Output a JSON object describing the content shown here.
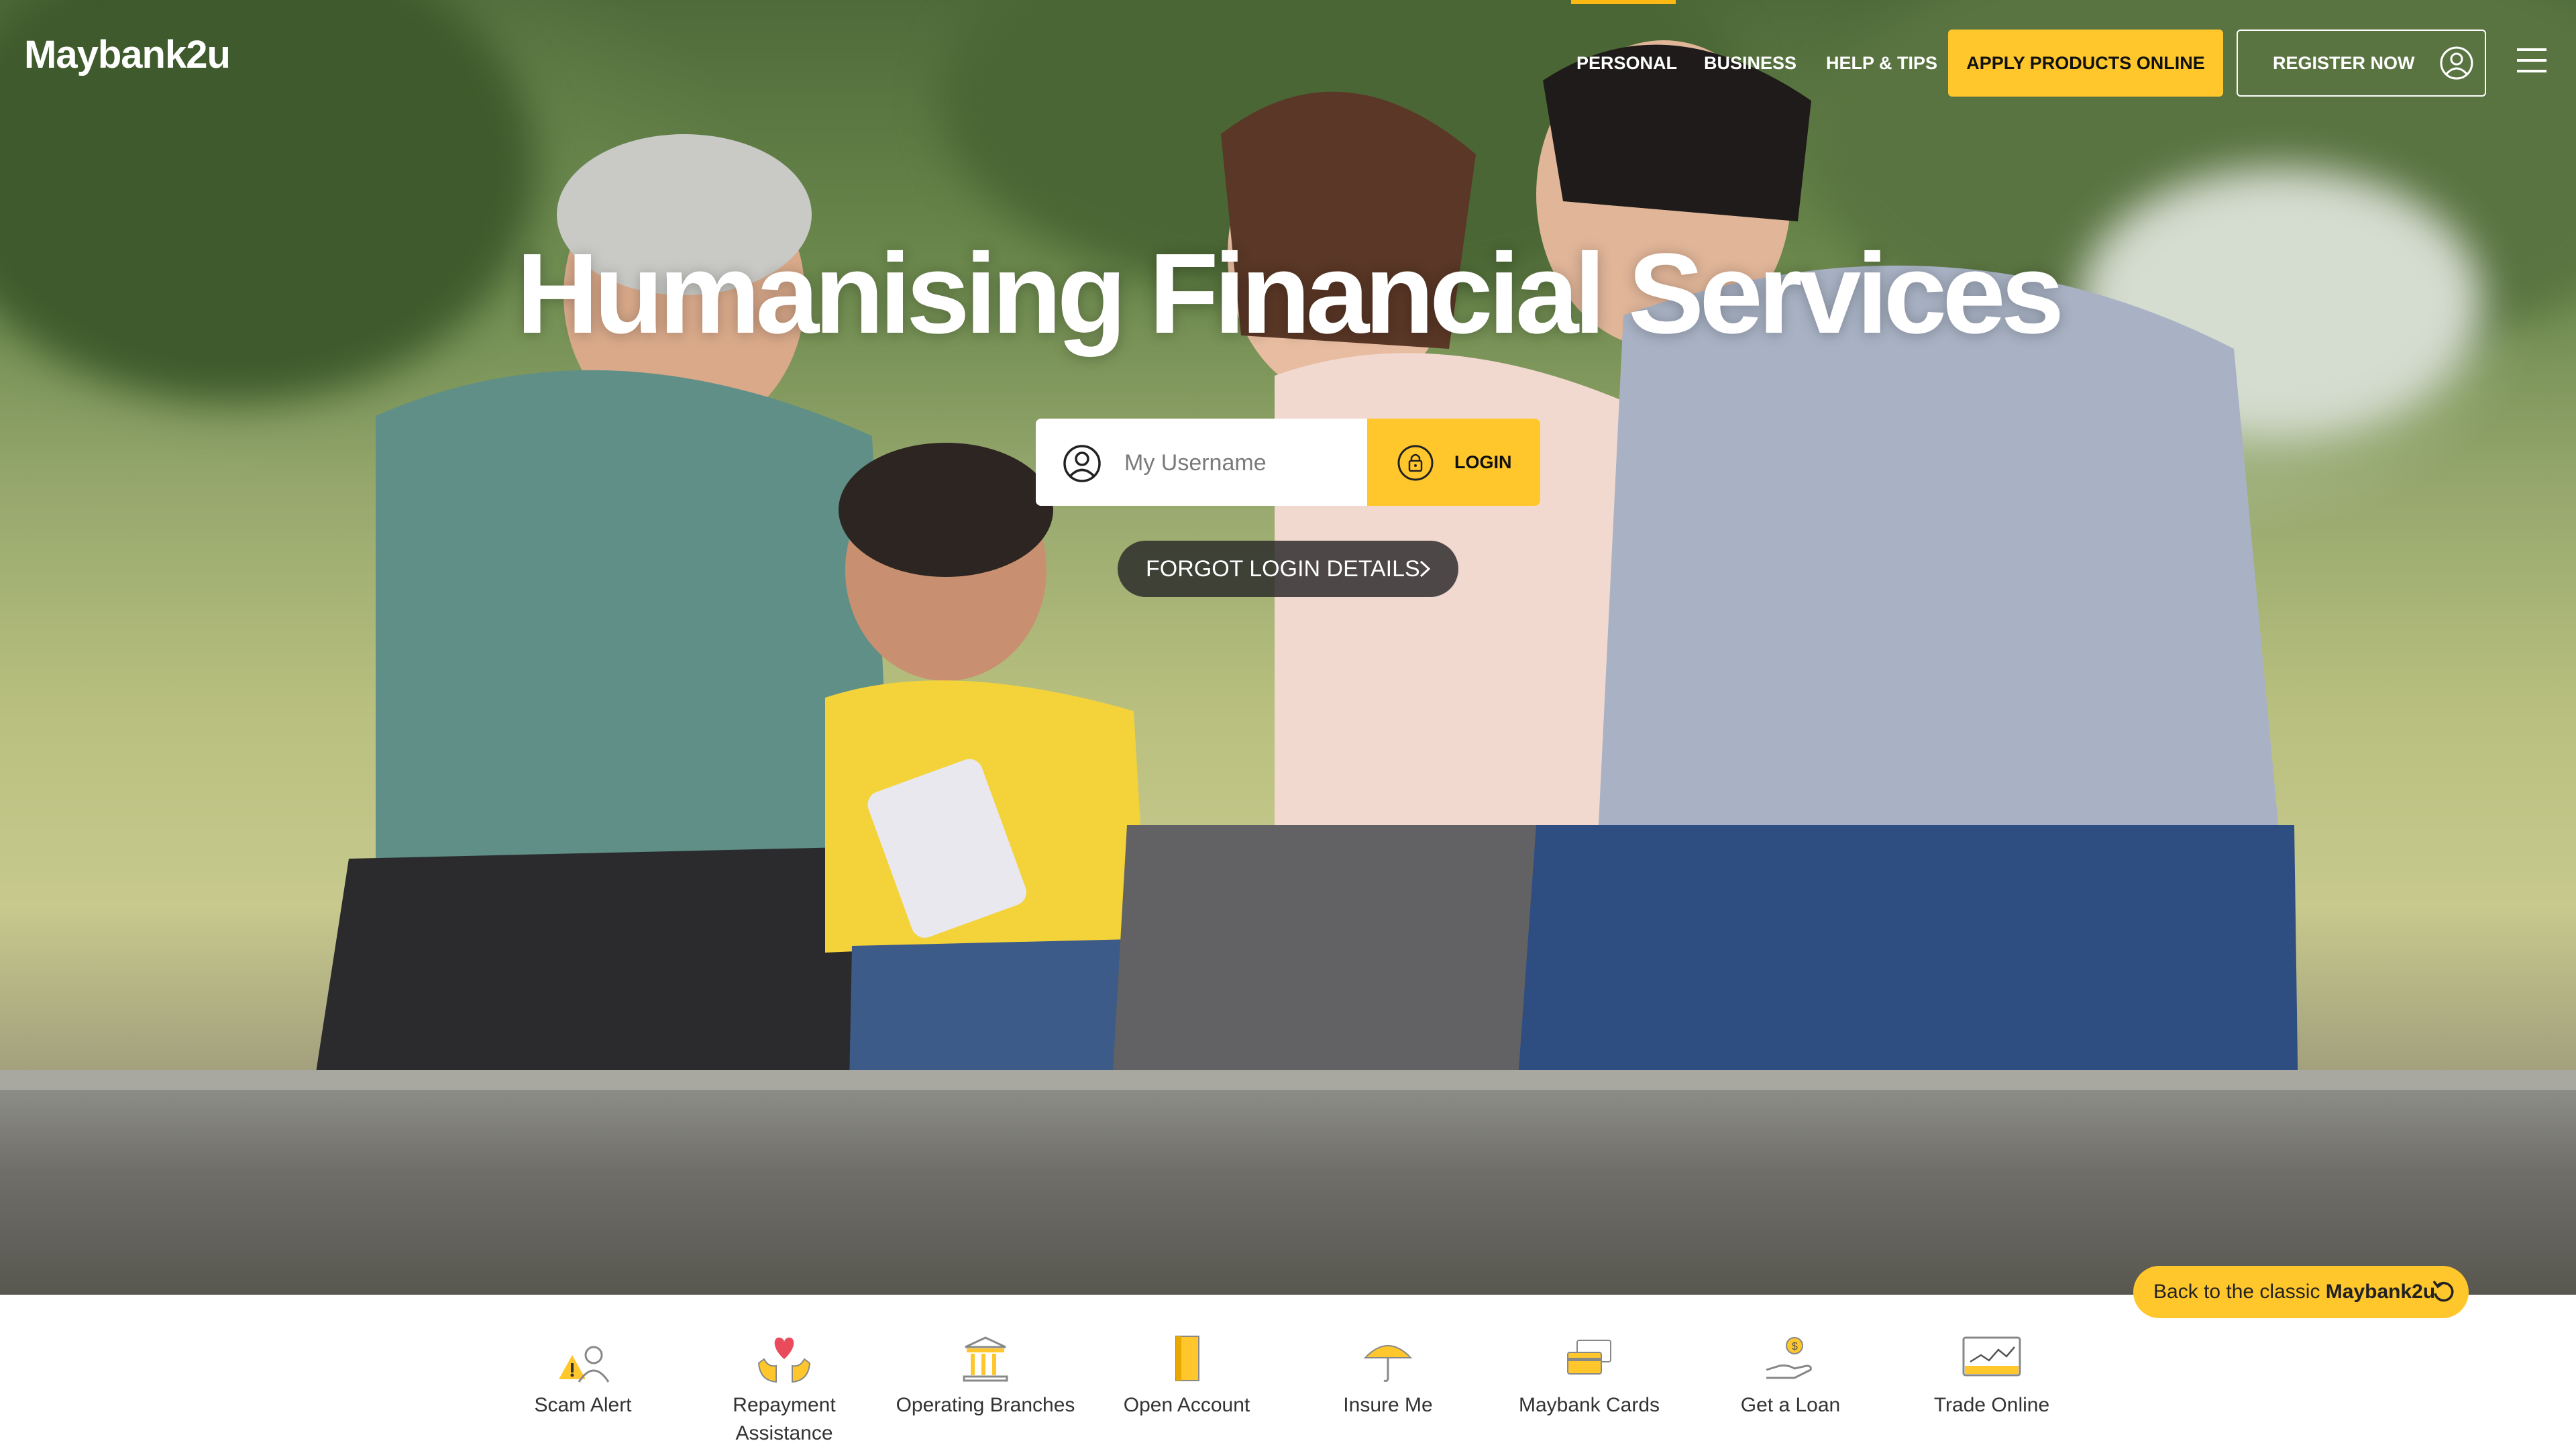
{
  "header": {
    "logo_text": "Maybank2u",
    "nav": [
      {
        "label": "PERSONAL",
        "active": true
      },
      {
        "label": "BUSINESS",
        "active": false
      },
      {
        "label": "HELP & TIPS",
        "active": false
      }
    ],
    "apply_label": "APPLY PRODUCTS ONLINE",
    "register_label": "REGISTER NOW",
    "register_icon": "user-circle-icon",
    "menu_icon": "hamburger-menu-icon"
  },
  "hero": {
    "headline": "Humanising Financial Services",
    "username_placeholder": "My Username",
    "username_icon": "user-circle-icon",
    "login_label": "LOGIN",
    "login_icon": "padlock-icon",
    "forgot_label": "FORGOT LOGIN DETAILS",
    "forgot_icon": "chevron-right-icon"
  },
  "classic": {
    "prefix": "Back to the classic ",
    "brand": "Maybank2u",
    "icon": "undo-arrow-icon"
  },
  "quick_links": [
    {
      "label": "Scam Alert",
      "icon": "scam-alert-icon"
    },
    {
      "label": "Repayment Assistance",
      "icon": "repayment-heart-hands-icon"
    },
    {
      "label": "Operating Branches",
      "icon": "bank-building-icon"
    },
    {
      "label": "Open Account",
      "icon": "open-account-book-icon"
    },
    {
      "label": "Insure Me",
      "icon": "umbrella-icon"
    },
    {
      "label": "Maybank Cards",
      "icon": "credit-cards-icon"
    },
    {
      "label": "Get a Loan",
      "icon": "loan-hand-coin-icon"
    },
    {
      "label": "Trade Online",
      "icon": "trade-chart-monitor-icon"
    }
  ],
  "colors": {
    "brand_yellow": "#ffc72c",
    "nav_active_underline": "#fdb913",
    "text_dark": "#333333",
    "pill_dark": "#282828"
  }
}
